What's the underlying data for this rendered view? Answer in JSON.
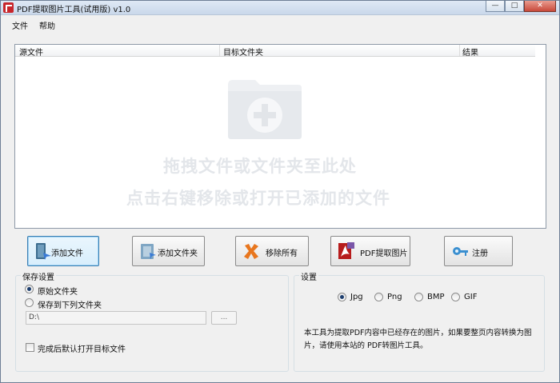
{
  "window": {
    "title": "PDF提取图片工具(试用版) v1.0",
    "controls": {
      "minimize": "—",
      "maximize": "□",
      "close": "✕"
    }
  },
  "menu": {
    "file": "文件",
    "help": "帮助"
  },
  "file_list": {
    "columns": [
      "源文件",
      "目标文件夹",
      "结果"
    ],
    "drop_hint_line1": "拖拽文件或文件夹至此处",
    "drop_hint_line2": "点击右键移除或打开已添加的文件",
    "placeholder_icon": "folder-plus-icon"
  },
  "toolbar": {
    "add_file": "添加文件",
    "add_folder": "添加文件夹",
    "remove_all": "移除所有",
    "pdf_extract": "PDF提取图片",
    "register": "注册"
  },
  "save_settings": {
    "title": "保存设置",
    "option_original": "原始文件夹",
    "option_custom": "保存到下列文件夹",
    "selected": "原始文件夹",
    "path_value": "D:\\",
    "browse_label": "...",
    "open_after_label": "完成后默认打开目标文件",
    "open_after_checked": false
  },
  "settings": {
    "title": "设置",
    "formats": [
      "Jpg",
      "Png",
      "BMP",
      "GIF"
    ],
    "selected_format": "Jpg",
    "description": "本工具为提取PDF内容中已经存在的图片，如果要整页内容转换为图片，请使用本站的 PDF转图片工具。"
  }
}
